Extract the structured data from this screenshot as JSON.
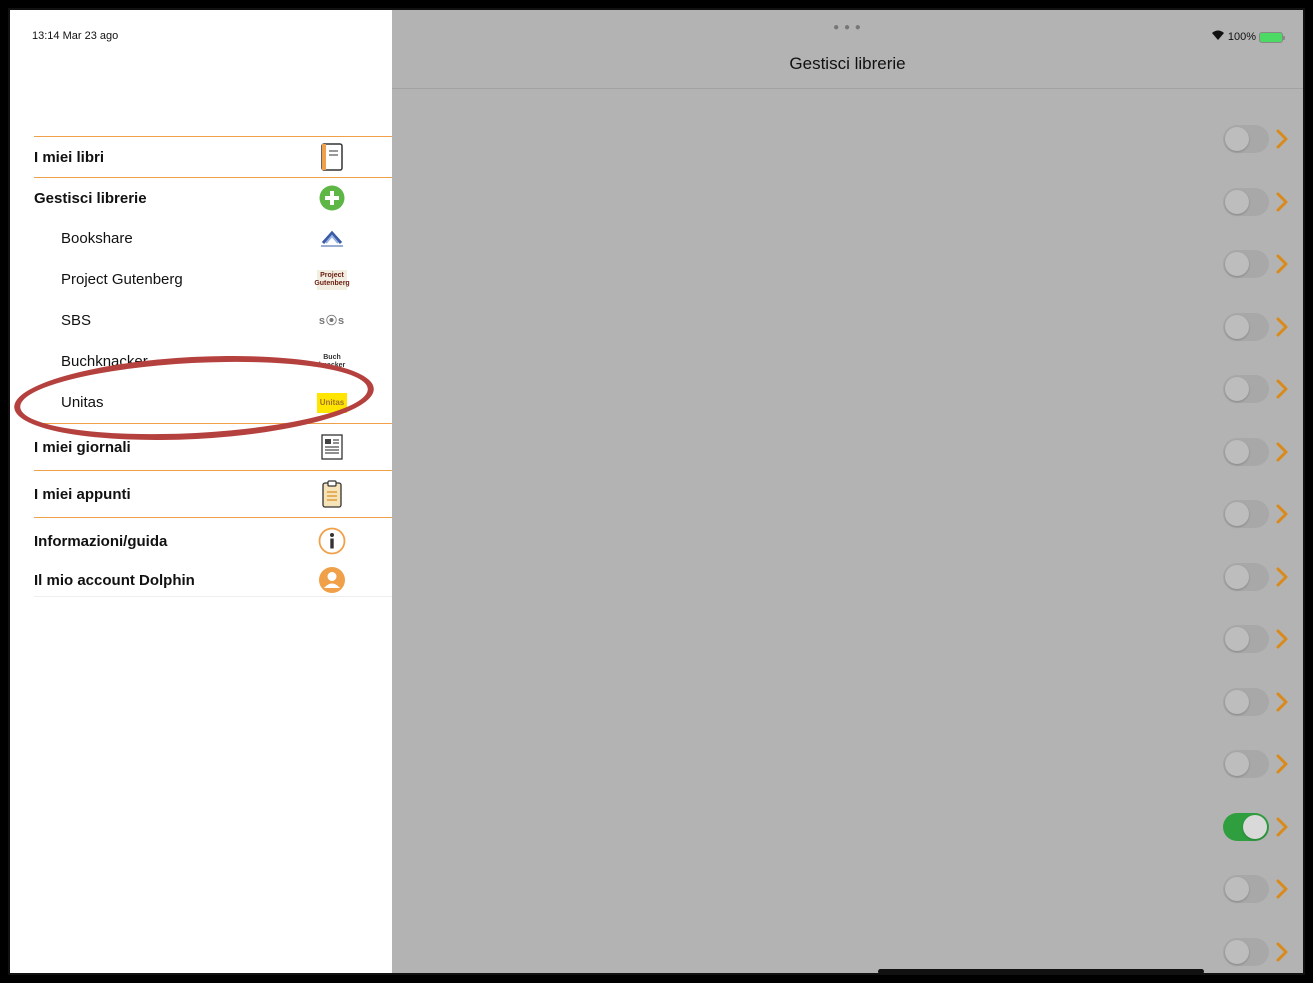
{
  "status": {
    "time": "13:14  Mar 23 ago",
    "battery": "100%",
    "wifi_icon": "wifi-icon"
  },
  "sidebar": {
    "items": [
      {
        "label": "I miei libri",
        "icon": "book-icon"
      },
      {
        "label": "Gestisci librerie",
        "icon": "add-circle-icon"
      },
      {
        "label": "Bookshare",
        "icon": "bookshare-logo"
      },
      {
        "label": "Project Gutenberg",
        "icon": "gutenberg-logo",
        "logo_text": "Project Gutenberg"
      },
      {
        "label": "SBS",
        "icon": "sbs-logo",
        "logo_text": "s⦿s"
      },
      {
        "label": "Buchknacker",
        "icon": "buchknacker-logo",
        "logo_text": "Buch knacker"
      },
      {
        "label": "Unitas",
        "icon": "unitas-logo",
        "logo_text": "Unitas"
      },
      {
        "label": "I miei giornali",
        "icon": "newspaper-icon"
      },
      {
        "label": "I miei appunti",
        "icon": "clipboard-icon"
      },
      {
        "label": "Informazioni/guida",
        "icon": "info-icon"
      },
      {
        "label": "Il mio account Dolphin",
        "icon": "account-icon"
      }
    ]
  },
  "main": {
    "title": "Gestisci librerie",
    "toggles": [
      false,
      false,
      false,
      false,
      false,
      false,
      false,
      false,
      false,
      false,
      false,
      true,
      false,
      false
    ]
  },
  "colors": {
    "accent": "#f0a048",
    "chevron": "#d98a1a",
    "switch_on": "#2f9e3f",
    "content_bg": "#b3b3b3",
    "annotation": "#b5413f"
  }
}
